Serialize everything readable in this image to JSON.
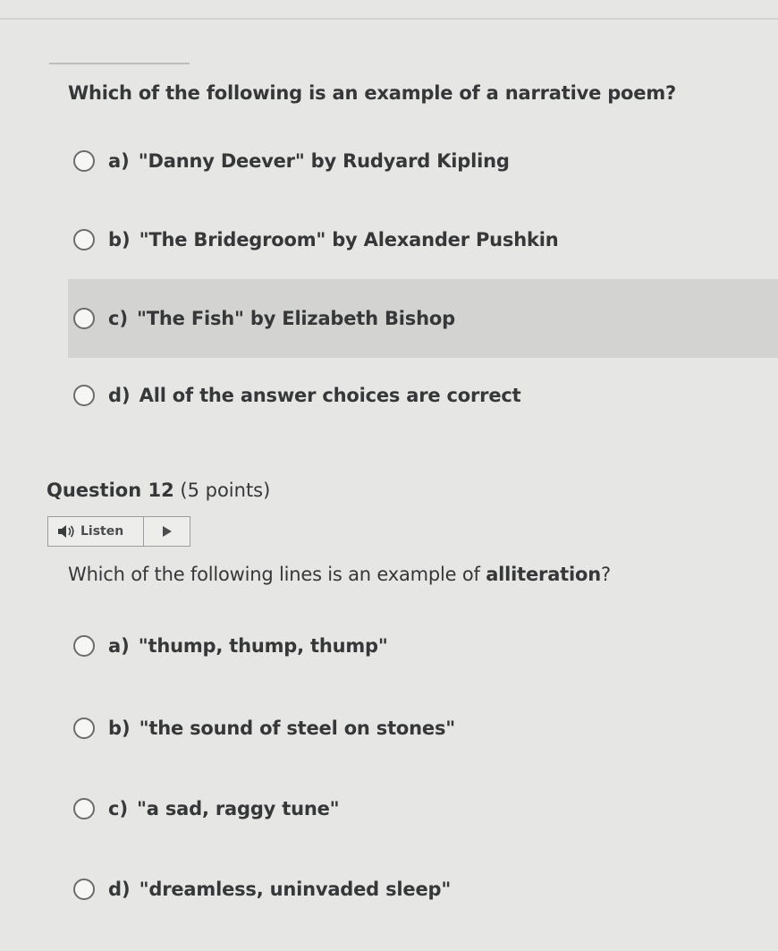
{
  "question11": {
    "text": "Which of the following is an example of a narrative poem?",
    "options": [
      {
        "letter": "a)",
        "text": "\"Danny Deever\" by Rudyard Kipling"
      },
      {
        "letter": "b)",
        "text": "\"The Bridegroom\" by Alexander Pushkin"
      },
      {
        "letter": "c)",
        "text": "\"The Fish\" by Elizabeth Bishop"
      },
      {
        "letter": "d)",
        "text": "All of the answer choices are correct"
      }
    ]
  },
  "question12": {
    "number": "Question 12",
    "points": "(5 points)",
    "listen_label": "Listen",
    "text_prefix": "Which of the following lines is an example of ",
    "text_bold": "alliteration",
    "text_suffix": "?",
    "options": [
      {
        "letter": "a)",
        "text": "\"thump, thump, thump\""
      },
      {
        "letter": "b)",
        "text": "\"the sound of steel on stones\""
      },
      {
        "letter": "c)",
        "text": "\"a sad, raggy tune\""
      },
      {
        "letter": "d)",
        "text": "\"dreamless, uninvaded sleep\""
      }
    ]
  },
  "icons": {
    "speaker": "speaker-icon",
    "play": "play-icon",
    "radio": "radio-button"
  },
  "colors": {
    "background": "#e6e6e4",
    "highlight_row": "#d3d3d1",
    "text": "#353739"
  }
}
